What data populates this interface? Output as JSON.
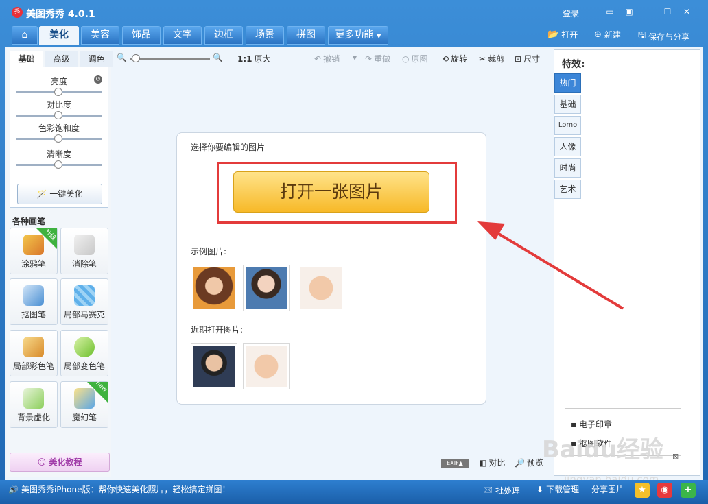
{
  "window": {
    "logo_glyph": "秀",
    "title": "美图秀秀 4.0.1",
    "login": "登录",
    "icons": [
      "chat-icon",
      "feedback-icon",
      "minimize-icon",
      "maximize-icon",
      "close-icon"
    ]
  },
  "main_tabs": [
    "美化",
    "美容",
    "饰品",
    "文字",
    "边框",
    "场景",
    "拼图",
    "更多功能"
  ],
  "main_tab_active": "美化",
  "top_actions": {
    "open": "打开",
    "new": "新建",
    "save_share": "保存与分享"
  },
  "left_panel": {
    "subtabs": [
      "基础",
      "高级",
      "调色"
    ],
    "sliders": [
      "亮度",
      "对比度",
      "色彩饱和度",
      "清晰度"
    ],
    "one_key": "一键美化",
    "brushes_title": "各种画笔",
    "brushes": [
      {
        "label": "涂鸦笔",
        "badge": "升级"
      },
      {
        "label": "消除笔",
        "badge": ""
      },
      {
        "label": "抠图笔",
        "badge": ""
      },
      {
        "label": "局部马赛克",
        "badge": ""
      },
      {
        "label": "局部彩色笔",
        "badge": ""
      },
      {
        "label": "局部变色笔",
        "badge": ""
      },
      {
        "label": "背景虚化",
        "badge": ""
      },
      {
        "label": "魔幻笔",
        "badge": "new"
      }
    ],
    "tutorial": "美化教程"
  },
  "toolbar": {
    "zoom_ratio": "1:1",
    "original_size": "原大",
    "undo": "撤销",
    "redo": "重做",
    "original": "原图",
    "rotate": "旋转",
    "crop": "裁剪",
    "size": "尺寸"
  },
  "card": {
    "prompt": "选择你要编辑的图片",
    "open_button": "打开一张图片",
    "samples_label": "示例图片:",
    "recent_label": "近期打开图片:"
  },
  "effects": {
    "title": "特效:",
    "tabs": [
      "热门",
      "基础",
      "Lomo",
      "人像",
      "时尚",
      "艺术"
    ],
    "active": "热门"
  },
  "ads": [
    "电子印章",
    "抠图软件"
  ],
  "ads_close": "⊠",
  "bottom_tools": {
    "exif": "EXIF▲",
    "compare": "对比",
    "preview": "预览"
  },
  "status": {
    "tip": "美图秀秀iPhone版：帮你快速美化照片，轻松搞定拼图！",
    "batch": "批处理",
    "download": "下载管理",
    "share": "分享图片"
  },
  "watermark": {
    "line1": "Baidu经验",
    "line2": "jingyan.baidu.com"
  },
  "colors": {
    "accent": "#1f67b3",
    "open_button": "#f7b928",
    "highlight_frame": "#e33b3b",
    "arrow": "#e33b3b"
  }
}
